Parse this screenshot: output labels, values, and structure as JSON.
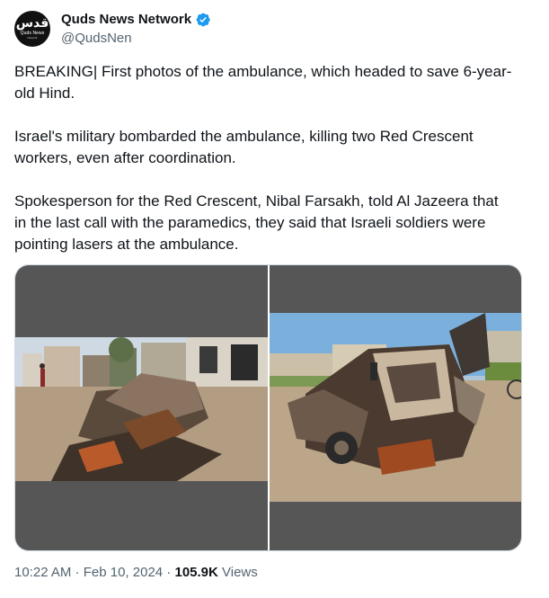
{
  "author": {
    "display_name": "Quds News Network",
    "handle": "@QudsNen",
    "avatar_mark": "قدس",
    "avatar_sub": "Quds News",
    "avatar_sub2": "Network",
    "verified_icon": "verified-badge-icon",
    "accent_color": "#1d9bf0"
  },
  "tweet": {
    "paragraphs": [
      "BREAKING| First photos of the ambulance, which headed to save 6-year-old Hind.",
      "Israel's military bombarded the ambulance, killing two Red Crescent workers, even after coordination.",
      "Spokesperson for the Red Crescent, Nibal Farsakh, told Al Jazeera that in the last call with the paramedics, they said that Israeli soldiers were pointing lasers at the ambulance."
    ],
    "media": [
      {
        "icon": "photo-destroyed-ambulance-rubble"
      },
      {
        "icon": "photo-burned-ambulance-vehicle"
      }
    ],
    "time": "10:22 AM",
    "separator": " · ",
    "date": "Feb 10, 2024",
    "views_count": "105.9K",
    "views_label": " Views"
  }
}
